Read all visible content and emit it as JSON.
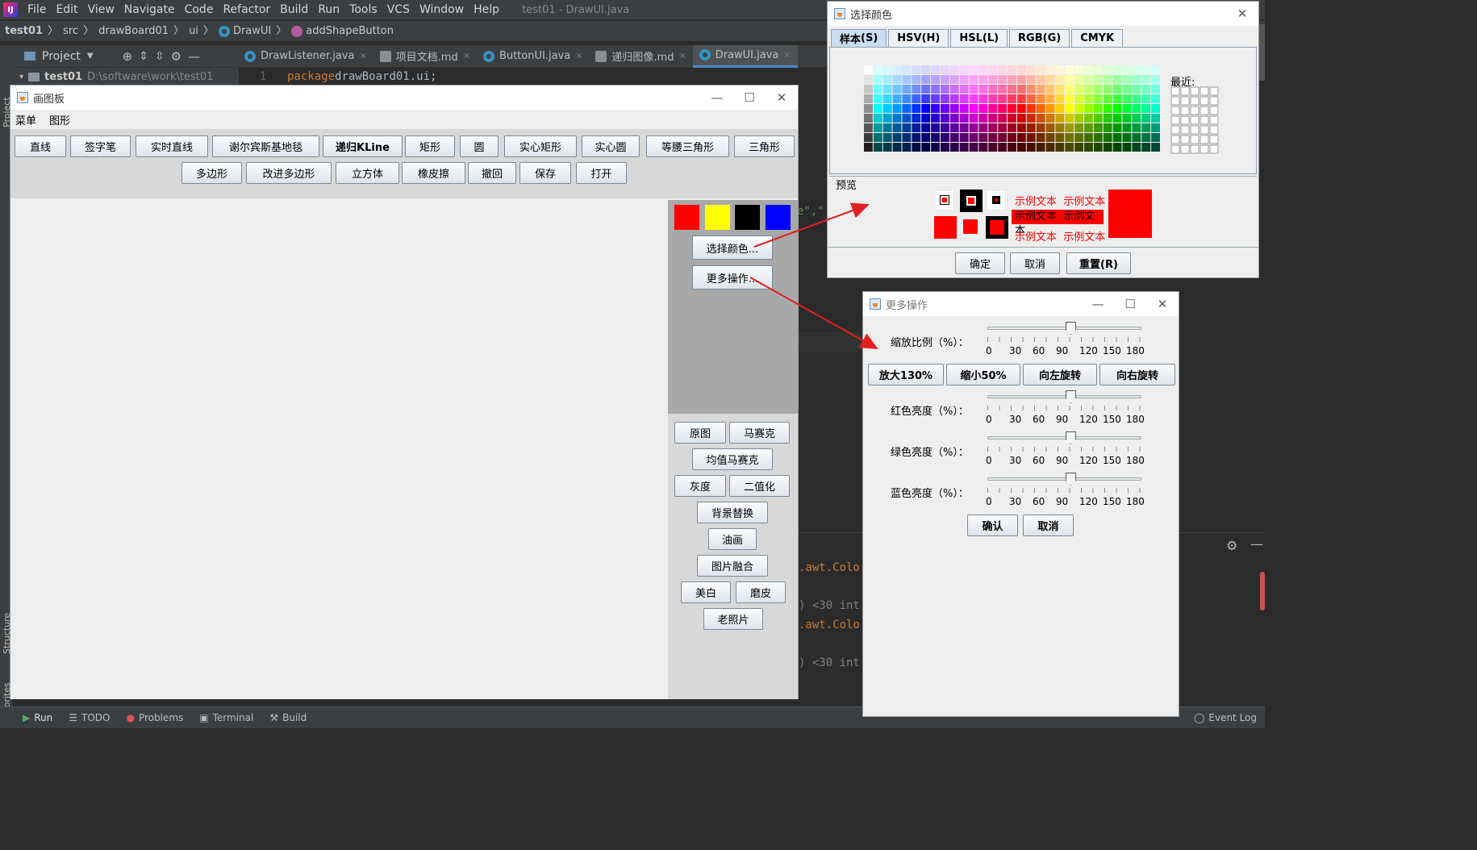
{
  "ide": {
    "menu": [
      "File",
      "Edit",
      "View",
      "Navigate",
      "Code",
      "Refactor",
      "Build",
      "Run",
      "Tools",
      "VCS",
      "Window",
      "Help"
    ],
    "window_title": "test01 - DrawUI.java",
    "breadcrumb": [
      "test01",
      "src",
      "drawBoard01",
      "ui",
      "DrawUI",
      "addShapeButton"
    ],
    "project_label": "Project",
    "tabs": [
      {
        "label": "DrawListener.java",
        "icon": "java-class-icon"
      },
      {
        "label": "项目文档.md",
        "icon": "markdown-icon"
      },
      {
        "label": "ButtonUI.java",
        "icon": "java-class-icon"
      },
      {
        "label": "递归图像.md",
        "icon": "markdown-icon"
      },
      {
        "label": "DrawUI.java",
        "icon": "java-class-icon"
      }
    ],
    "tree_root": "test01",
    "tree_root_path": "D:\\software\\work\\test01",
    "code_line_no": "1",
    "code_keyword": "package",
    "code_pkg": " drawBoard01.ui;",
    "code_fragments": [
      ".awt.Colo",
      ") <30 int",
      ".awt.Colo",
      ") <30 int"
    ],
    "code_snip": "e\",\"",
    "side_labels": [
      "Project",
      "Structure",
      "Favorites"
    ],
    "statusbar": [
      "Run",
      "TODO",
      "Problems",
      "Terminal",
      "Build",
      "Event Log"
    ]
  },
  "drawboard": {
    "title": "画图板",
    "menus": [
      "菜单",
      "图形"
    ],
    "row1": [
      "直线",
      "签字笔",
      "实时直线",
      "谢尔宾斯基地毯",
      "递归KLine",
      "矩形",
      "圆",
      "实心矩形",
      "实心圆",
      "等腰三角形",
      "三角形"
    ],
    "row2": [
      "多边形",
      "改进多边形",
      "立方体",
      "橡皮擦",
      "撤回",
      "保存",
      "打开"
    ],
    "colors": [
      "#ff0000",
      "#ffff00",
      "#000000",
      "#0000ff"
    ],
    "choose_color": "选择颜色...",
    "more_ops": "更多操作...",
    "filters": [
      "原图",
      "马赛克",
      "均值马赛克",
      "灰度",
      "二值化",
      "背景替换",
      "油画",
      "图片融合",
      "美白",
      "磨皮",
      "老照片"
    ]
  },
  "color_dialog": {
    "title": "选择颜色",
    "tabs": [
      {
        "label": "样本",
        "key": "(S)"
      },
      {
        "label": "HSV",
        "key": "(H)"
      },
      {
        "label": "HSL",
        "key": "(L)"
      },
      {
        "label": "RGB",
        "key": "(G)"
      },
      {
        "label": "CMYK",
        "key": ""
      }
    ],
    "recent_label": "最近:",
    "preview_label": "预览",
    "sample_text": "示例文本",
    "buttons": {
      "ok": "确定",
      "cancel": "取消",
      "reset": "重置(R)"
    },
    "selected_color": "#ff0000"
  },
  "more_dialog": {
    "title": "更多操作",
    "scale_label": "缩放比例（%）：",
    "tick_labels": [
      "0",
      "30",
      "60",
      "90",
      "120",
      "150",
      "180"
    ],
    "buttons": [
      "放大130%",
      "缩小50%",
      "向左旋转",
      "向右旋转"
    ],
    "red_label": "红色亮度（%）：",
    "green_label": "绿色亮度（%）：",
    "blue_label": "蓝色亮度（%）：",
    "slider_values_percent": {
      "scale": 100,
      "red": 100,
      "green": 100,
      "blue": 100
    },
    "confirm": "确认",
    "cancel": "取消"
  }
}
